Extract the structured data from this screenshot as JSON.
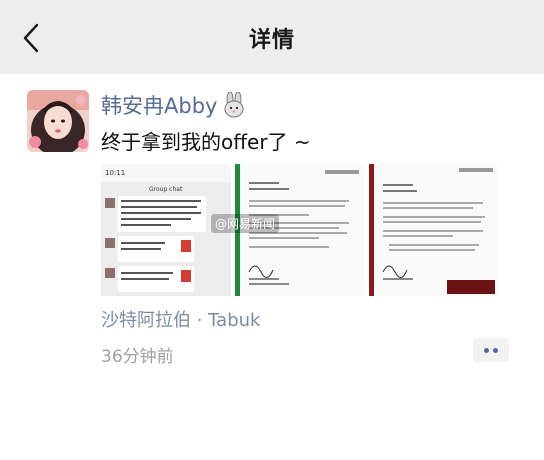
{
  "header": {
    "title": "详情",
    "back_icon": "chevron-left-icon"
  },
  "post": {
    "author": "韩安冉Abby",
    "author_emoji": "🐰",
    "text": "终于拿到我的offer了 ~",
    "watermark": "@网易新闻",
    "location": "沙特阿拉伯 · Tabuk",
    "time": "36分钟前",
    "more_icon": "more-dots-icon",
    "images": [
      {
        "name": "chat-screenshot",
        "chat_title": "Group chat",
        "time_label": "10:11"
      },
      {
        "name": "offer-letter-page-1",
        "accent": "#1e8a3a"
      },
      {
        "name": "offer-letter-page-2",
        "accent": "#8b1a1a"
      }
    ]
  }
}
